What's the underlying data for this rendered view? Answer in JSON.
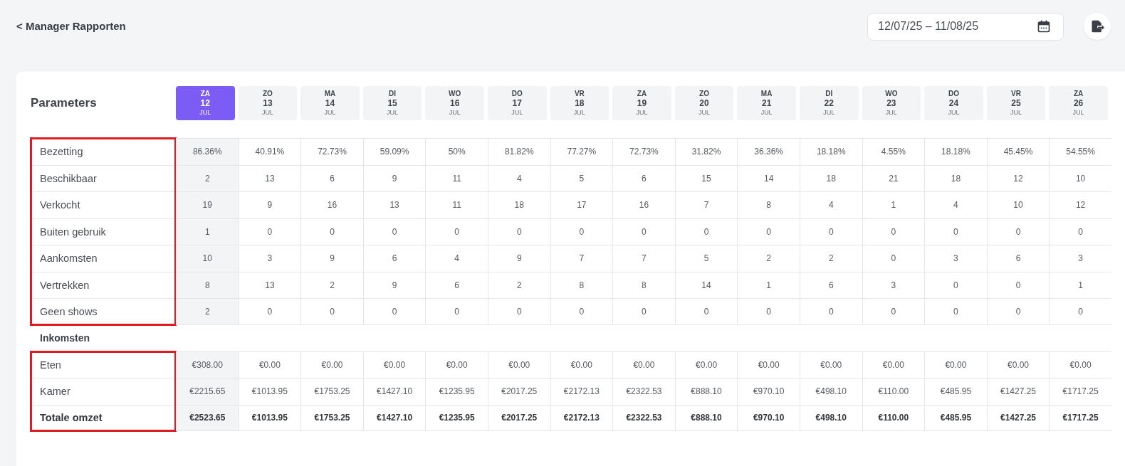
{
  "back_link": "< Manager Rapporten",
  "date_range": {
    "value": "12/07/25 – 11/08/25"
  },
  "parameters_title": "Parameters",
  "days": [
    {
      "weekday": "ZA",
      "day": "12",
      "month": "JUL",
      "selected": true
    },
    {
      "weekday": "ZO",
      "day": "13",
      "month": "JUL",
      "selected": false
    },
    {
      "weekday": "MA",
      "day": "14",
      "month": "JUL",
      "selected": false
    },
    {
      "weekday": "DI",
      "day": "15",
      "month": "JUL",
      "selected": false
    },
    {
      "weekday": "WO",
      "day": "16",
      "month": "JUL",
      "selected": false
    },
    {
      "weekday": "DO",
      "day": "17",
      "month": "JUL",
      "selected": false
    },
    {
      "weekday": "VR",
      "day": "18",
      "month": "JUL",
      "selected": false
    },
    {
      "weekday": "ZA",
      "day": "19",
      "month": "JUL",
      "selected": false
    },
    {
      "weekday": "ZO",
      "day": "20",
      "month": "JUL",
      "selected": false
    },
    {
      "weekday": "MA",
      "day": "21",
      "month": "JUL",
      "selected": false
    },
    {
      "weekday": "DI",
      "day": "22",
      "month": "JUL",
      "selected": false
    },
    {
      "weekday": "WO",
      "day": "23",
      "month": "JUL",
      "selected": false
    },
    {
      "weekday": "DO",
      "day": "24",
      "month": "JUL",
      "selected": false
    },
    {
      "weekday": "VR",
      "day": "25",
      "month": "JUL",
      "selected": false
    },
    {
      "weekday": "ZA",
      "day": "26",
      "month": "JUL",
      "selected": false
    }
  ],
  "sections": [
    {
      "highlighted": true,
      "rows": [
        {
          "label": "Bezetting",
          "kind": "value",
          "values": [
            "86.36%",
            "40.91%",
            "72.73%",
            "59.09%",
            "50%",
            "81.82%",
            "77.27%",
            "72.73%",
            "31.82%",
            "36.36%",
            "18.18%",
            "4.55%",
            "18.18%",
            "45.45%",
            "54.55%"
          ]
        },
        {
          "label": "Beschikbaar",
          "kind": "value",
          "values": [
            "2",
            "13",
            "6",
            "9",
            "11",
            "4",
            "5",
            "6",
            "15",
            "14",
            "18",
            "21",
            "18",
            "12",
            "10"
          ]
        },
        {
          "label": "Verkocht",
          "kind": "value",
          "values": [
            "19",
            "9",
            "16",
            "13",
            "11",
            "18",
            "17",
            "16",
            "7",
            "8",
            "4",
            "1",
            "4",
            "10",
            "12"
          ]
        },
        {
          "label": "Buiten gebruik",
          "kind": "value",
          "values": [
            "1",
            "0",
            "0",
            "0",
            "0",
            "0",
            "0",
            "0",
            "0",
            "0",
            "0",
            "0",
            "0",
            "0",
            "0"
          ]
        },
        {
          "label": "Aankomsten",
          "kind": "value",
          "values": [
            "10",
            "3",
            "9",
            "6",
            "4",
            "9",
            "7",
            "7",
            "5",
            "2",
            "2",
            "0",
            "3",
            "6",
            "3"
          ]
        },
        {
          "label": "Vertrekken",
          "kind": "value",
          "values": [
            "8",
            "13",
            "2",
            "9",
            "6",
            "2",
            "8",
            "8",
            "14",
            "1",
            "6",
            "3",
            "0",
            "0",
            "1"
          ]
        },
        {
          "label": "Geen shows",
          "kind": "value",
          "values": [
            "2",
            "0",
            "0",
            "0",
            "0",
            "0",
            "0",
            "0",
            "0",
            "0",
            "0",
            "0",
            "0",
            "0",
            "0"
          ]
        }
      ]
    },
    {
      "title": "Inkomsten",
      "highlighted": true,
      "rows": [
        {
          "label": "Eten",
          "kind": "value",
          "values": [
            "€308.00",
            "€0.00",
            "€0.00",
            "€0.00",
            "€0.00",
            "€0.00",
            "€0.00",
            "€0.00",
            "€0.00",
            "€0.00",
            "€0.00",
            "€0.00",
            "€0.00",
            "€0.00",
            "€0.00"
          ]
        },
        {
          "label": "Kamer",
          "kind": "value",
          "values": [
            "€2215.65",
            "€1013.95",
            "€1753.25",
            "€1427.10",
            "€1235.95",
            "€2017.25",
            "€2172.13",
            "€2322.53",
            "€888.10",
            "€970.10",
            "€498.10",
            "€110.00",
            "€485.95",
            "€1427.25",
            "€1717.25"
          ]
        },
        {
          "label": "Totale omzet",
          "kind": "total",
          "values": [
            "€2523.65",
            "€1013.95",
            "€1753.25",
            "€1427.10",
            "€1235.95",
            "€2017.25",
            "€2172.13",
            "€2322.53",
            "€888.10",
            "€970.10",
            "€498.10",
            "€110.00",
            "€485.95",
            "€1427.25",
            "€1717.25"
          ]
        }
      ]
    }
  ]
}
